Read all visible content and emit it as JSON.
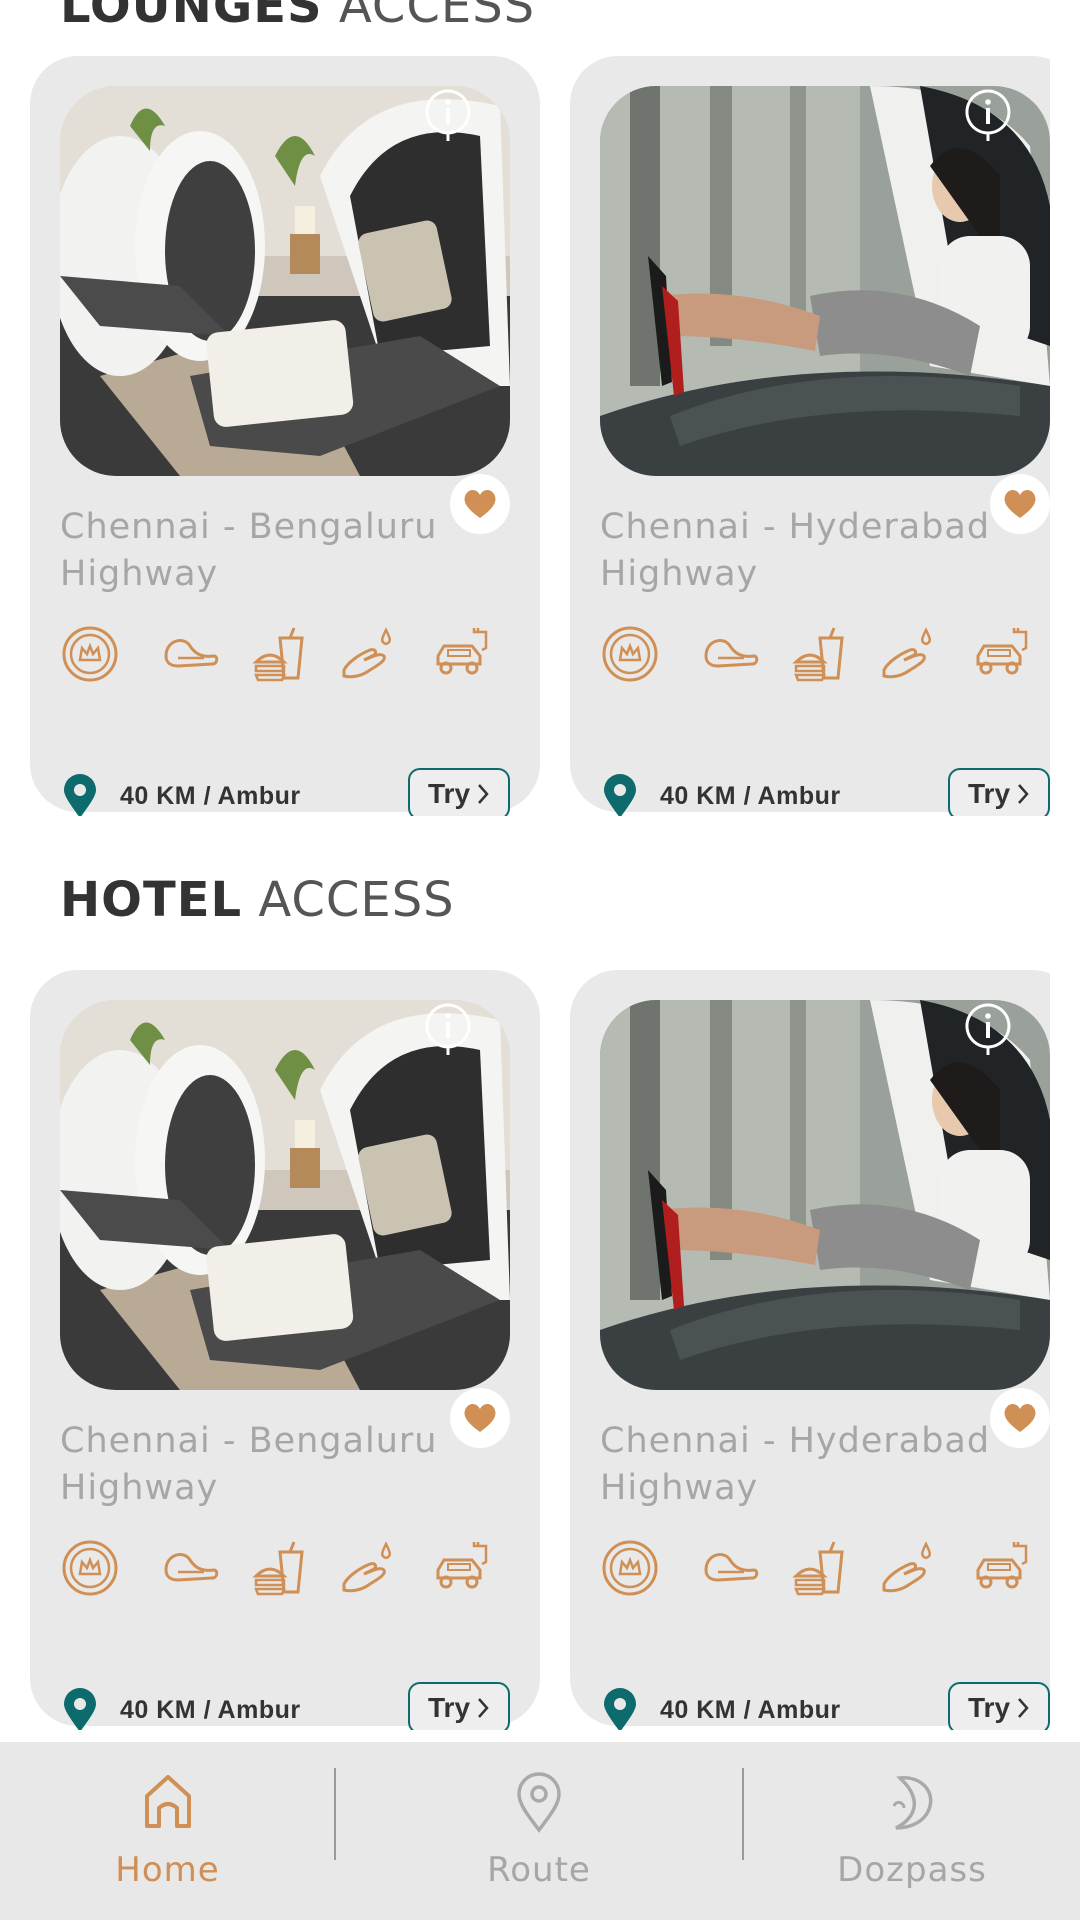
{
  "sections": [
    {
      "title_bold": "LOUNGES",
      "title_light": "ACCESS",
      "cards": [
        {
          "title_line1": "Chennai - Bengaluru",
          "title_line2": "Highway",
          "distance": "40 KM / Ambur",
          "cta": "Try",
          "image": "sleep-pods-lounge"
        },
        {
          "title_line1": "Chennai - Hyderabad",
          "title_line2": "Highway",
          "distance": "40 KM / Ambur",
          "cta": "Try",
          "image": "woman-resting-in-pod"
        }
      ]
    },
    {
      "title_bold": "HOTEL",
      "title_light": "ACCESS",
      "cards": [
        {
          "title_line1": "Chennai - Bengaluru",
          "title_line2": "Highway",
          "distance": "40 KM / Ambur",
          "cta": "Try",
          "image": "sleep-pods-lounge"
        },
        {
          "title_line1": "Chennai - Hyderabad",
          "title_line2": "Highway",
          "distance": "40 KM / Ambur",
          "cta": "Try",
          "image": "woman-resting-in-pod"
        }
      ]
    }
  ],
  "amenity_icons": [
    "crown-badge-icon",
    "sleep-pod-icon",
    "food-drink-icon",
    "hand-wash-icon",
    "ev-charging-car-icon"
  ],
  "bottom_nav": {
    "items": [
      {
        "label": "Home",
        "icon": "home-icon",
        "active": true
      },
      {
        "label": "Route",
        "icon": "location-pin-icon",
        "active": false
      },
      {
        "label": "Dozpass",
        "icon": "dozpass-icon",
        "active": false
      }
    ]
  },
  "colors": {
    "accent": "#d08f55",
    "teal": "#0e6b6d",
    "card_bg": "#e9e9e9",
    "nav_bg": "#e8e8e8",
    "muted_text": "#a6a6a6"
  }
}
